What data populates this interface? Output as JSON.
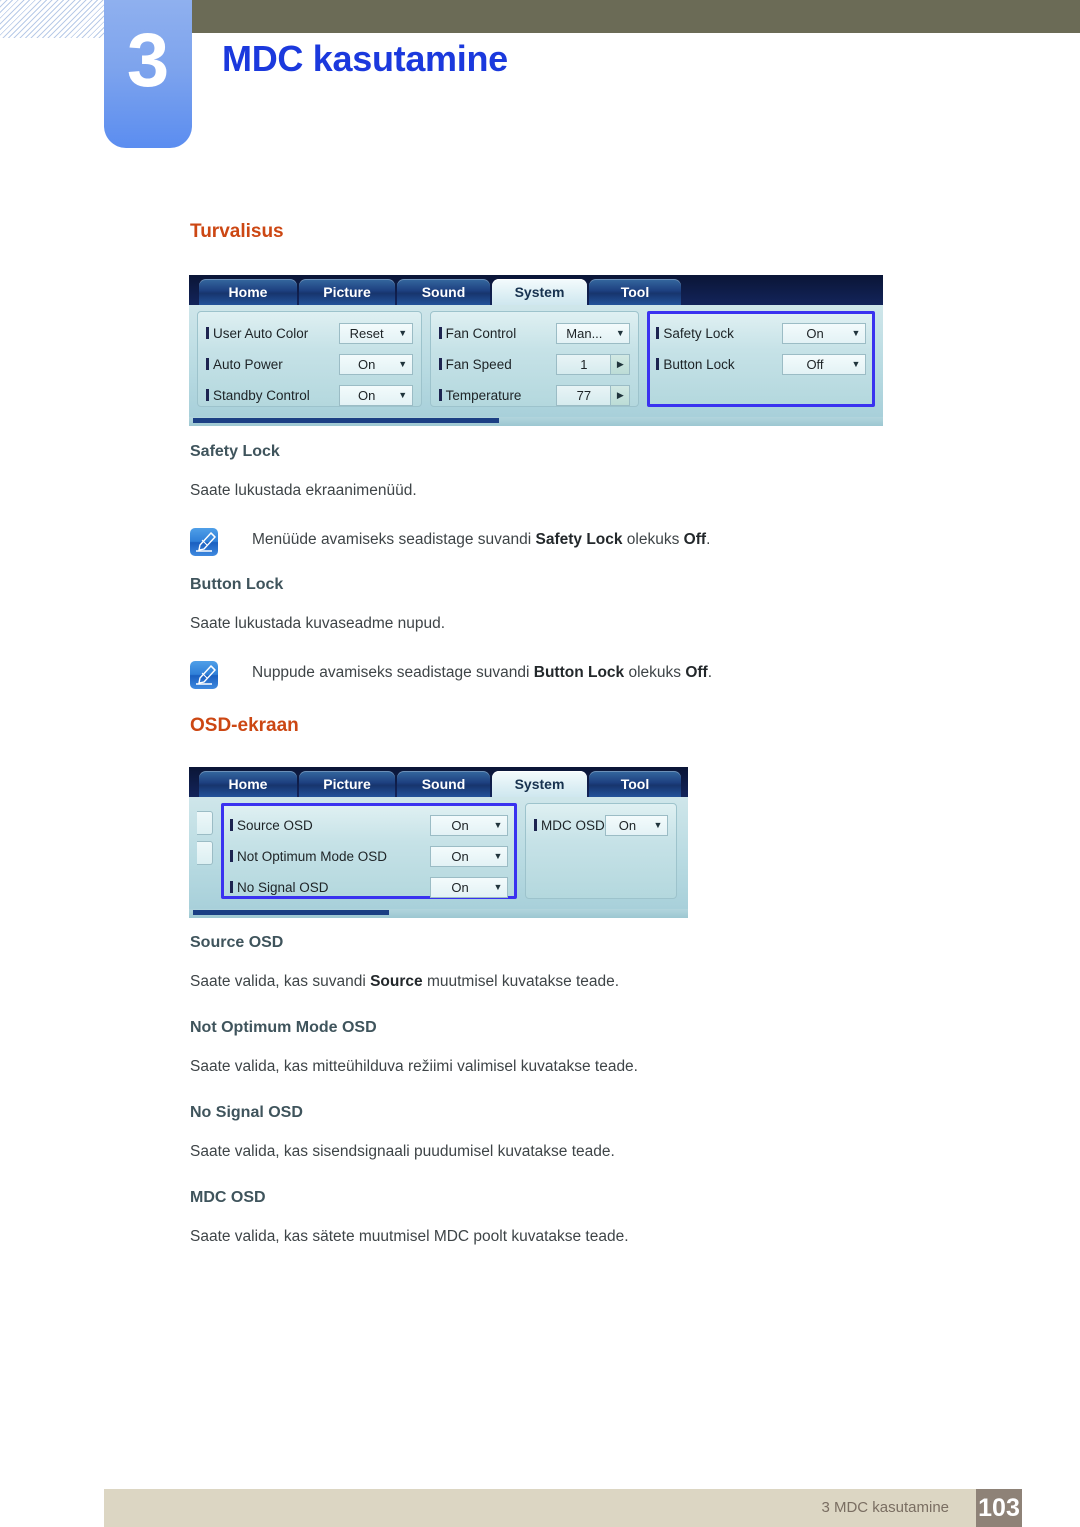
{
  "header": {
    "chapter_number": "3",
    "chapter_title": "MDC kasutamine"
  },
  "sections": [
    {
      "heading": "Turvalisus",
      "widget": {
        "tabs": [
          {
            "label": "Home",
            "active": false
          },
          {
            "label": "Picture",
            "active": false
          },
          {
            "label": "Sound",
            "active": false
          },
          {
            "label": "System",
            "active": true
          },
          {
            "label": "Tool",
            "active": false
          }
        ],
        "panels": [
          {
            "highlighted": false,
            "rows": [
              {
                "label": "User Auto Color",
                "value": "Reset",
                "control": "dropdown"
              },
              {
                "label": "Auto Power",
                "value": "On",
                "control": "dropdown"
              },
              {
                "label": "Standby Control",
                "value": "On",
                "control": "dropdown"
              }
            ]
          },
          {
            "highlighted": false,
            "rows": [
              {
                "label": "Fan Control",
                "value": "Man...",
                "control": "dropdown"
              },
              {
                "label": "Fan Speed",
                "value": "1",
                "control": "spinner"
              },
              {
                "label": "Temperature",
                "value": "77",
                "control": "spinner"
              }
            ]
          },
          {
            "highlighted": true,
            "rows": [
              {
                "label": "Safety Lock",
                "value": "On",
                "control": "dropdown"
              },
              {
                "label": "Button Lock",
                "value": "Off",
                "control": "dropdown"
              }
            ]
          }
        ]
      },
      "blocks": [
        {
          "type": "subhead",
          "text": "Safety Lock"
        },
        {
          "type": "para",
          "text": "Saate lukustada ekraanimenüüd."
        },
        {
          "type": "note",
          "pre": "Menüüde avamiseks seadistage suvandi ",
          "bold1": "Safety Lock",
          "mid": " olekuks ",
          "bold2": "Off",
          "post": "."
        },
        {
          "type": "subhead",
          "text": "Button Lock"
        },
        {
          "type": "para",
          "text": "Saate lukustada kuvaseadme nupud."
        },
        {
          "type": "note",
          "pre": "Nuppude avamiseks seadistage suvandi ",
          "bold1": "Button Lock",
          "mid": " olekuks ",
          "bold2": "Off",
          "post": "."
        }
      ]
    },
    {
      "heading": "OSD-ekraan",
      "widget": {
        "tabs": [
          {
            "label": "Home",
            "active": false
          },
          {
            "label": "Picture",
            "active": false
          },
          {
            "label": "Sound",
            "active": false
          },
          {
            "label": "System",
            "active": true
          },
          {
            "label": "Tool",
            "active": false
          }
        ],
        "panels": [
          {
            "highlighted": true,
            "rows": [
              {
                "label": "Source OSD",
                "value": "On",
                "control": "dropdown"
              },
              {
                "label": "Not Optimum Mode OSD",
                "value": "On",
                "control": "dropdown"
              },
              {
                "label": "No Signal OSD",
                "value": "On",
                "control": "dropdown"
              }
            ]
          },
          {
            "highlighted": false,
            "rows": [
              {
                "label": "MDC OSD",
                "value": "On",
                "control": "dropdown"
              }
            ]
          }
        ]
      },
      "blocks": [
        {
          "type": "subhead",
          "text": "Source OSD"
        },
        {
          "type": "para_bold",
          "pre": "Saate valida, kas suvandi ",
          "bold1": "Source",
          "post": " muutmisel kuvatakse teade."
        },
        {
          "type": "subhead",
          "text": "Not Optimum Mode OSD"
        },
        {
          "type": "para",
          "text": "Saate valida, kas mitteühilduva režiimi valimisel kuvatakse teade."
        },
        {
          "type": "subhead",
          "text": "No Signal OSD"
        },
        {
          "type": "para",
          "text": "Saate valida, kas sisendsignaali puudumisel kuvatakse teade."
        },
        {
          "type": "subhead",
          "text": "MDC OSD"
        },
        {
          "type": "para",
          "text": "Saate valida, kas sätete muutmisel MDC poolt kuvatakse teade."
        }
      ]
    }
  ],
  "footer": {
    "text": "3 MDC kasutamine",
    "page": "103"
  },
  "colors": {
    "accent_heading": "#cc4713",
    "chapter_title": "#1b39dd",
    "chapter_tab": "#7ea4ed",
    "top_bar": "#6b6b56",
    "footer_bar": "#dcd6c3",
    "page_box": "#8e8277",
    "highlight_border": "#3a32f0"
  }
}
